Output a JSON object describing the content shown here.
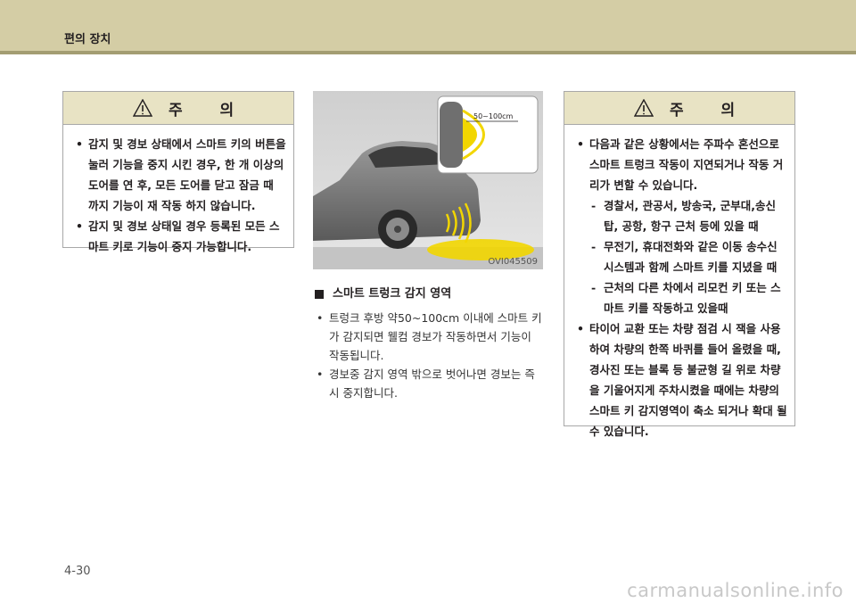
{
  "header": {
    "title": "편의 장치"
  },
  "caution_left": {
    "heading": "주 의",
    "items": [
      {
        "type": "bullet",
        "text": "감지 및 경보 상태에서 스마트 키의 버튼을 눌러 기능을 중지 시킨 경우, 한 개 이상의 도어를 연 후, 모든 도어를 닫고 잠금 때 까지 기능이 재 작동 하지 않습니다."
      },
      {
        "type": "bullet",
        "text": "감지 및 경보 상태일 경우 등록된 모든 스마트 키로 기능이 중지 가능합니다."
      }
    ]
  },
  "figure": {
    "code": "OVI045509",
    "range_label": "50~100cm"
  },
  "section": {
    "title": "스마트 트렁크 감지 영역",
    "items": [
      "트렁크 후방 약50~100cm 이내에 스마트 키가 감지되면 웰컴 경보가 작동하면서 기능이 작동됩니다.",
      "경보중 감지 영역 밖으로 벗어나면 경보는 즉시 중지합니다."
    ]
  },
  "caution_right": {
    "heading": "주 의",
    "items": [
      {
        "type": "bullet",
        "text": "다음과 같은 상황에서는 주파수 혼선으로 스마트 트렁크 작동이 지연되거나 작동 거리가 변할 수 있습니다."
      },
      {
        "type": "dash",
        "text": "경찰서, 관공서, 방송국, 군부대,송신탑, 공항, 항구 근처 등에 있을 때"
      },
      {
        "type": "dash",
        "text": "무전기, 휴대전화와 같은 이동 송수신 시스템과 함께 스마트 키를 지녔을 때"
      },
      {
        "type": "dash",
        "text": "근처의 다른 차에서 리모컨 키 또는 스마트 키를 작동하고 있을때"
      },
      {
        "type": "bullet",
        "text": "타이어 교환 또는 차량 점검 시 잭을 사용하여 차량의 한쪽 바퀴를 들어 올렸을 때, 경사진 또는 블록 등 불균형 길 위로 차량을 기울어지게 주차시켰을 때에는 차량의 스마트 키 감지영역이 축소 되거나 확대 될 수 있습니다."
      }
    ]
  },
  "page_number": "4-30",
  "watermark": "carmanualsonline.info",
  "colors": {
    "header_band": "#d4cda5",
    "caution_head": "#e8e3c4",
    "detection_zone": "#f2d600"
  }
}
